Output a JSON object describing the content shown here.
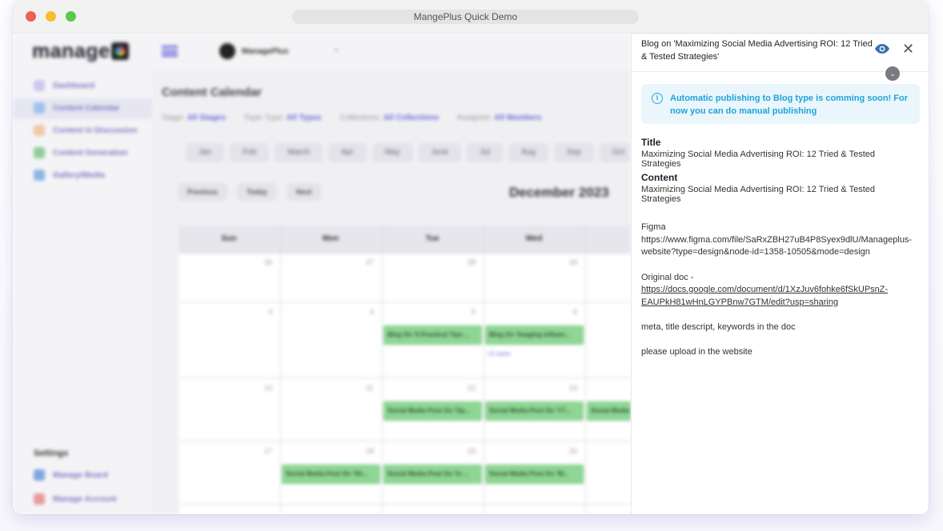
{
  "window": {
    "title": "MangePlus Quick Demo"
  },
  "sidebar": {
    "logo_text": "manage",
    "items": [
      {
        "label": "Dashboard",
        "active": false
      },
      {
        "label": "Content Calendar",
        "active": true
      },
      {
        "label": "Content In Discussion",
        "active": false
      },
      {
        "label": "Content Generation",
        "active": false
      },
      {
        "label": "Gallery/Media",
        "active": false
      }
    ],
    "settings_title": "Settings",
    "settings_items": [
      {
        "label": "Manage Board"
      },
      {
        "label": "Manage Account"
      }
    ]
  },
  "topbar": {
    "workspace": "ManagePlus"
  },
  "calendar": {
    "title": "Content Calendar",
    "filters": [
      {
        "label": "Stage:",
        "value": "All Stages"
      },
      {
        "label": "Topic Type:",
        "value": "All Types"
      },
      {
        "label": "Collections:",
        "value": "All Collections"
      },
      {
        "label": "Assignee:",
        "value": "All Members"
      }
    ],
    "months": [
      "Jan",
      "Feb",
      "March",
      "Apr",
      "May",
      "June",
      "Jul",
      "Aug",
      "Sep",
      "Oct"
    ],
    "nav": {
      "previous": "Previous",
      "today": "Today",
      "next": "Next"
    },
    "current_month": "December 2023",
    "day_names": [
      "Sun",
      "Mon",
      "Tue",
      "Wed"
    ],
    "day_numbers": [
      "26",
      "27",
      "28",
      "29",
      "3",
      "4",
      "5",
      "6",
      "10",
      "11",
      "12",
      "13",
      "17",
      "18",
      "19",
      "20"
    ],
    "events": [
      "Blog On '6 Practical Tips ...",
      "Blog On 'Imaging Influen...",
      "Social Media Post On 'Op...",
      "Social Media Post On 'Y7...",
      "Social Media",
      "Social Media Post On 'Sh...",
      "Social Media Post On 'In ...",
      "Social Media Post On 'W..."
    ],
    "more_link": "+2 more"
  },
  "panel": {
    "header_title": "Blog on 'Maximizing Social Media Advertising ROI: 12 Tried & Tested Strategies'",
    "alert": "Automatic publishing to Blog type is comming soon! For now you can do manual publishing",
    "title_label": "Title",
    "title_value": "Maximizing Social Media Advertising ROI: 12 Tried & Tested Strategies",
    "content_label": "Content",
    "content_value": "Maximizing Social Media Advertising ROI: 12 Tried & Tested Strategies",
    "figma_label": "Figma",
    "figma_url_1": "https://www.figma.com/file/SaRxZBH27uB4P8Syex9dlU/Manageplus-",
    "figma_url_2": "website?type=design&node-id=1358-10505&mode=design",
    "doc_label": "Original doc -",
    "doc_url_1": "https://docs.google.com/document/d/1XzJuv6fohke6fSkUPsnZ-",
    "doc_url_2": "EAUPkH81wHnLGYPBnw7GTM/edit?usp=sharing",
    "meta_note": "meta, title descript, keywords in the doc",
    "upload_note": "please upload in the website"
  },
  "colors": {
    "accent": "#6c6ad8",
    "info": "#1fa3d8",
    "event": "#8ed694"
  }
}
